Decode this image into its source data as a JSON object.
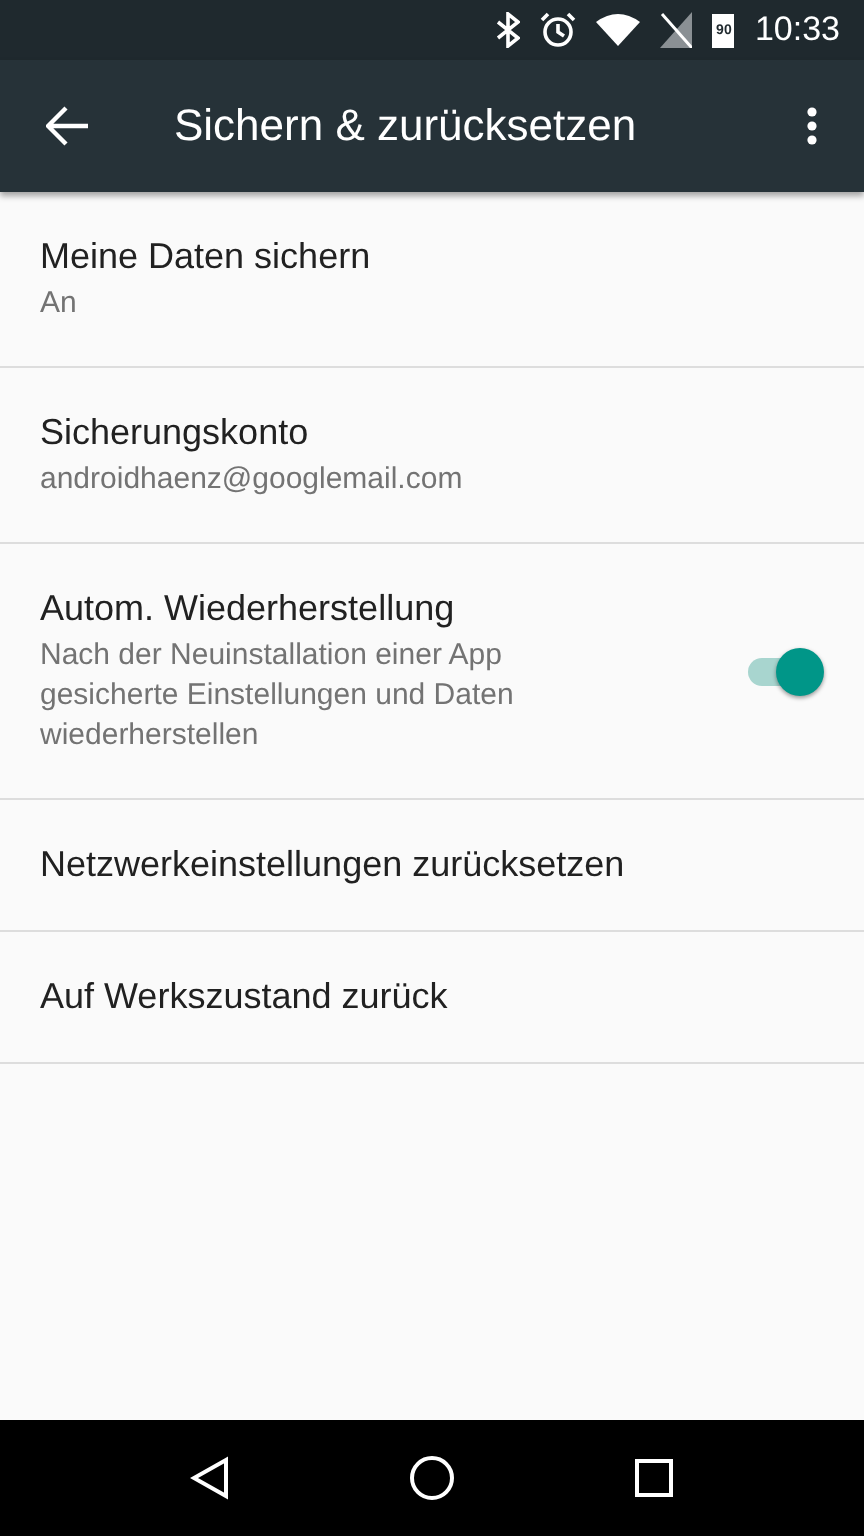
{
  "status_bar": {
    "battery": "90",
    "time": "10:33"
  },
  "toolbar": {
    "title": "Sichern & zurücksetzen"
  },
  "items": [
    {
      "kind": "text",
      "title": "Meine Daten sichern",
      "summary": "An"
    },
    {
      "kind": "text",
      "title": "Sicherungskonto",
      "summary": "androidhaenz@googlemail.com"
    },
    {
      "kind": "switch",
      "title": "Autom. Wiederherstellung",
      "summary": "Nach der Neuinstallation einer App gesicherte Einstellungen und Daten wiederherstellen",
      "on": true
    },
    {
      "kind": "text",
      "title": "Netzwerkeinstellungen zurücksetzen"
    },
    {
      "kind": "text",
      "title": "Auf Werkszustand zurück"
    }
  ]
}
